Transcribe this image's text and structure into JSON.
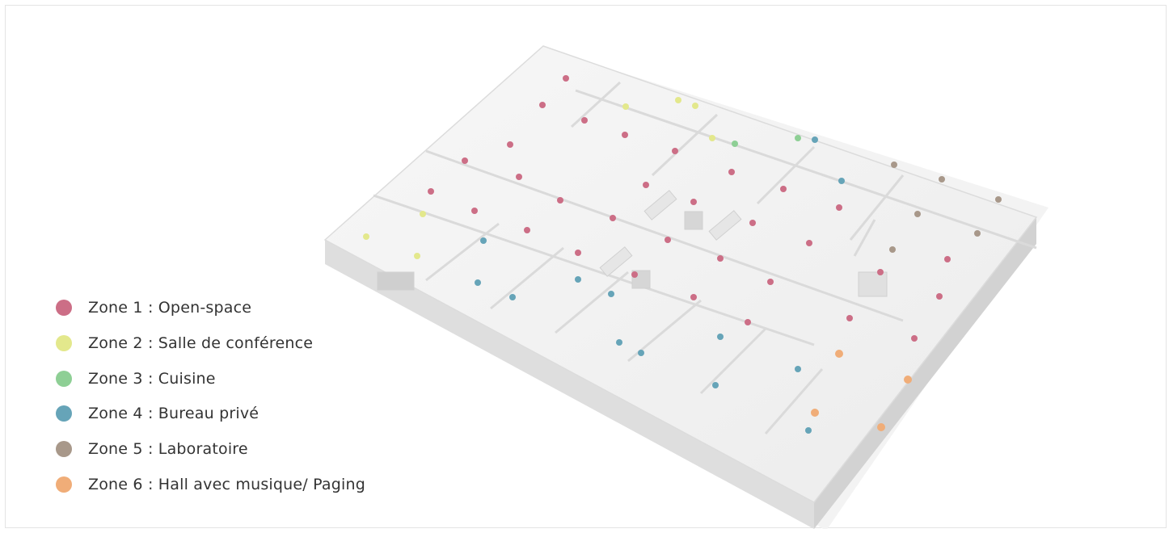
{
  "zones": [
    {
      "id": 1,
      "label": "Zone 1 : Open-space",
      "color": "#cc6e86"
    },
    {
      "id": 2,
      "label": "Zone 2 : Salle de conférence",
      "color": "#e3e88c"
    },
    {
      "id": 3,
      "label": "Zone 3 : Cuisine",
      "color": "#8ecf95"
    },
    {
      "id": 4,
      "label": "Zone 4 : Bureau privé",
      "color": "#66a4b8"
    },
    {
      "id": 5,
      "label": "Zone 5 : Laboratoire",
      "color": "#a8988a"
    },
    {
      "id": 6,
      "label": "Zone 6 : Hall avec musique/ Paging",
      "color": "#f0ad78"
    }
  ]
}
